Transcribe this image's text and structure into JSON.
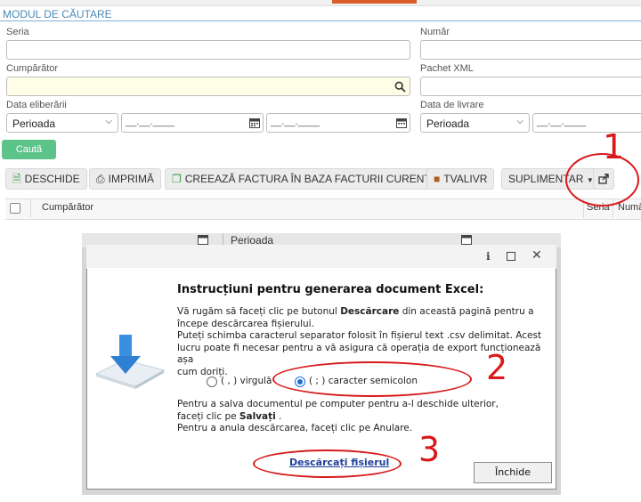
{
  "module": {
    "title": "MODUL DE CĂUTARE"
  },
  "form": {
    "seria_label": "Seria",
    "numar_label": "Număr",
    "cumparator_label": "Cumpărător",
    "pachet_label": "Pachet XML",
    "data_eliberarii_label": "Data eliberării",
    "data_livrare_label": "Data de livrare",
    "perioada": "Perioada",
    "date_placeholder": "__.__.____",
    "search_button": "Caută"
  },
  "toolbar": {
    "deschide": "DESCHIDE",
    "imprima": "IMPRIMĂ",
    "creeaza": "CREEAZĂ FACTURA ÎN BAZA FACTURII CURENTE",
    "tvalivr": "TVALIVR",
    "suplimentar": "SUPLIMENTAR"
  },
  "table": {
    "columns": [
      "Cumpărător",
      "Seria",
      "Numă"
    ]
  },
  "background": {
    "perioada": "Perioada"
  },
  "dialog": {
    "title": "Instrucțiuni pentru generarea document Excel:",
    "p1_a": "Vă rugăm să faceți clic pe butonul ",
    "p1_b": "Descărcare",
    "p1_c": " din această pagină pentru a",
    "p1_d": "începe descărcarea fișierului.",
    "p2_a": "Puteți schimba caracterul separator folosit în fișierul text .csv delimitat. Acest",
    "p2_b": "lucru poate fi necesar pentru a vă asigura că operația de export funcționează așa",
    "p2_c": "cum doriți.",
    "opt_comma": "( , ) virgulă",
    "opt_semicolon": "( ; ) caracter semicolon",
    "p3_a": "Pentru a salva documentul pe computer pentru a-l deschide ulterior,",
    "p3_b": "faceți clic pe ",
    "p3_c": "Salvați",
    "p3_d": " .",
    "p4": "Pentru a anula descărcarea, faceți clic pe Anulare.",
    "download_link": "Descărcați fișierul",
    "close_button": "Închide",
    "selected_option": "semicolon"
  },
  "annotations": {
    "n1": "1",
    "n2": "2",
    "n3": "3",
    "color": "#d81a1a"
  },
  "icons": [
    "calendar-icon",
    "search-icon",
    "file-icon",
    "print-icon",
    "copy-icon",
    "truck-icon",
    "export-icon",
    "excel-download-icon",
    "info-icon",
    "maximize-icon",
    "close-icon"
  ],
  "colors": {
    "accent": "#4a8ab5",
    "green": "#5cc489",
    "tab_indicator": "#d95c2b"
  }
}
